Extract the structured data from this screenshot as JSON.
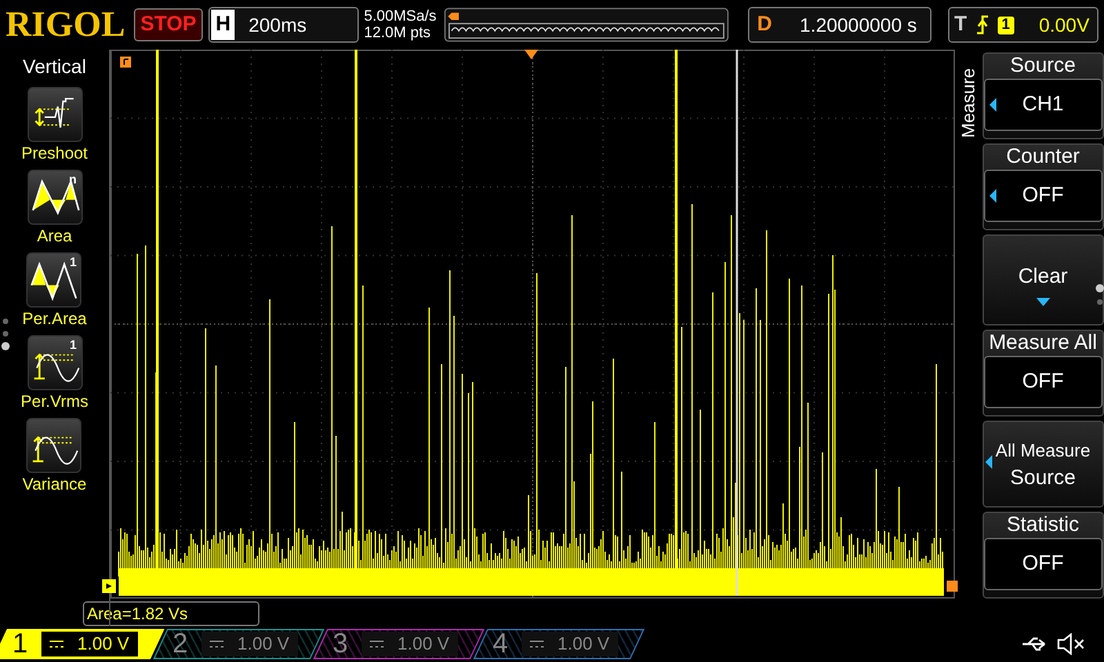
{
  "brand": "RIGOL",
  "run_state": "STOP",
  "timebase": {
    "label": "H",
    "value": "200ms"
  },
  "sample_rate": "5.00MSa/s",
  "memory_depth": "12.0M pts",
  "delay": {
    "label": "D",
    "value": "1.20000000 s"
  },
  "trigger": {
    "label": "T",
    "source": "1",
    "level": "0.00V"
  },
  "left_menu": {
    "title": "Vertical",
    "items": [
      {
        "label": "Preshoot",
        "kind": "preshoot"
      },
      {
        "label": "Area",
        "kind": "area",
        "badge": "n"
      },
      {
        "label": "Per.Area",
        "kind": "per_area",
        "badge": "1"
      },
      {
        "label": "Per.Vrms",
        "kind": "per_vrms",
        "badge": "1"
      },
      {
        "label": "Variance",
        "kind": "variance"
      }
    ]
  },
  "right_menu": {
    "title": "Measure",
    "items": [
      {
        "kind": "option",
        "title": "Source",
        "value": "CH1",
        "arrow": true
      },
      {
        "kind": "option",
        "title": "Counter",
        "value": "OFF",
        "arrow": true
      },
      {
        "kind": "expand",
        "title": "Clear"
      },
      {
        "kind": "option",
        "title": "Measure All",
        "value": "OFF",
        "arrow": false
      },
      {
        "kind": "action",
        "title": "All Measure",
        "subtitle": "Source",
        "arrow": true
      },
      {
        "kind": "option",
        "title": "Statistic",
        "value": "OFF",
        "arrow": false
      }
    ]
  },
  "measurement": "Area=1.82 Vs",
  "channels": [
    {
      "number": "1",
      "scale": "1.00 V",
      "selected": true,
      "color": "#ffff00"
    },
    {
      "number": "2",
      "scale": "1.00 V",
      "selected": false,
      "color": "#1f8f8f"
    },
    {
      "number": "3",
      "scale": "1.00 V",
      "selected": false,
      "color": "#b02ab0"
    },
    {
      "number": "4",
      "scale": "1.00 V",
      "selected": false,
      "color": "#2f6fb0"
    }
  ]
}
